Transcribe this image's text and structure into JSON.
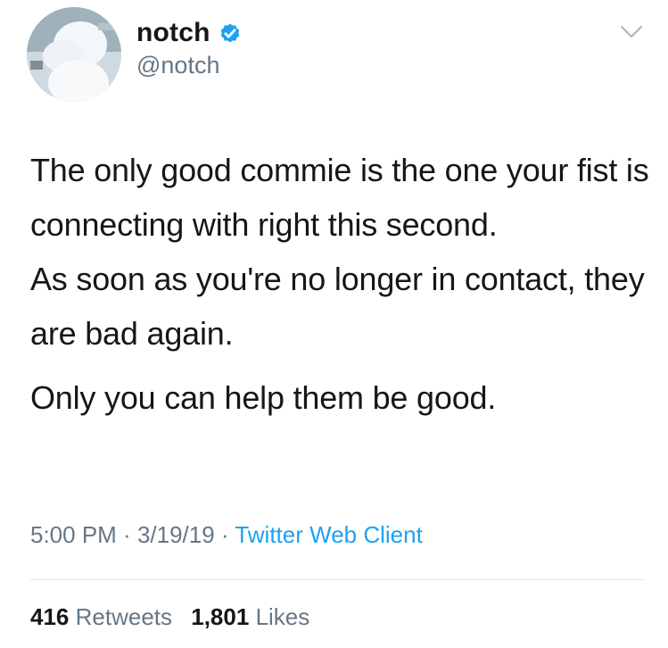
{
  "user": {
    "display_name": "notch",
    "handle": "@notch",
    "verified": true,
    "verified_color": "#1da1f2"
  },
  "tweet": {
    "paragraphs": [
      "The only good commie is the one your fist is connecting with right this second.",
      "As soon as you're no longer in contact, they are bad again.",
      "Only you can help them be good."
    ]
  },
  "meta": {
    "time": "5:00 PM",
    "separator": " · ",
    "date": "3/19/19",
    "client": "Twitter Web Client",
    "client_color": "#1da1f2"
  },
  "stats": {
    "retweets_count": "416",
    "retweets_label": "Retweets",
    "likes_count": "1,801",
    "likes_label": "Likes"
  },
  "icons": {
    "verified": "verified-badge-icon",
    "menu": "chevron-down-icon"
  }
}
